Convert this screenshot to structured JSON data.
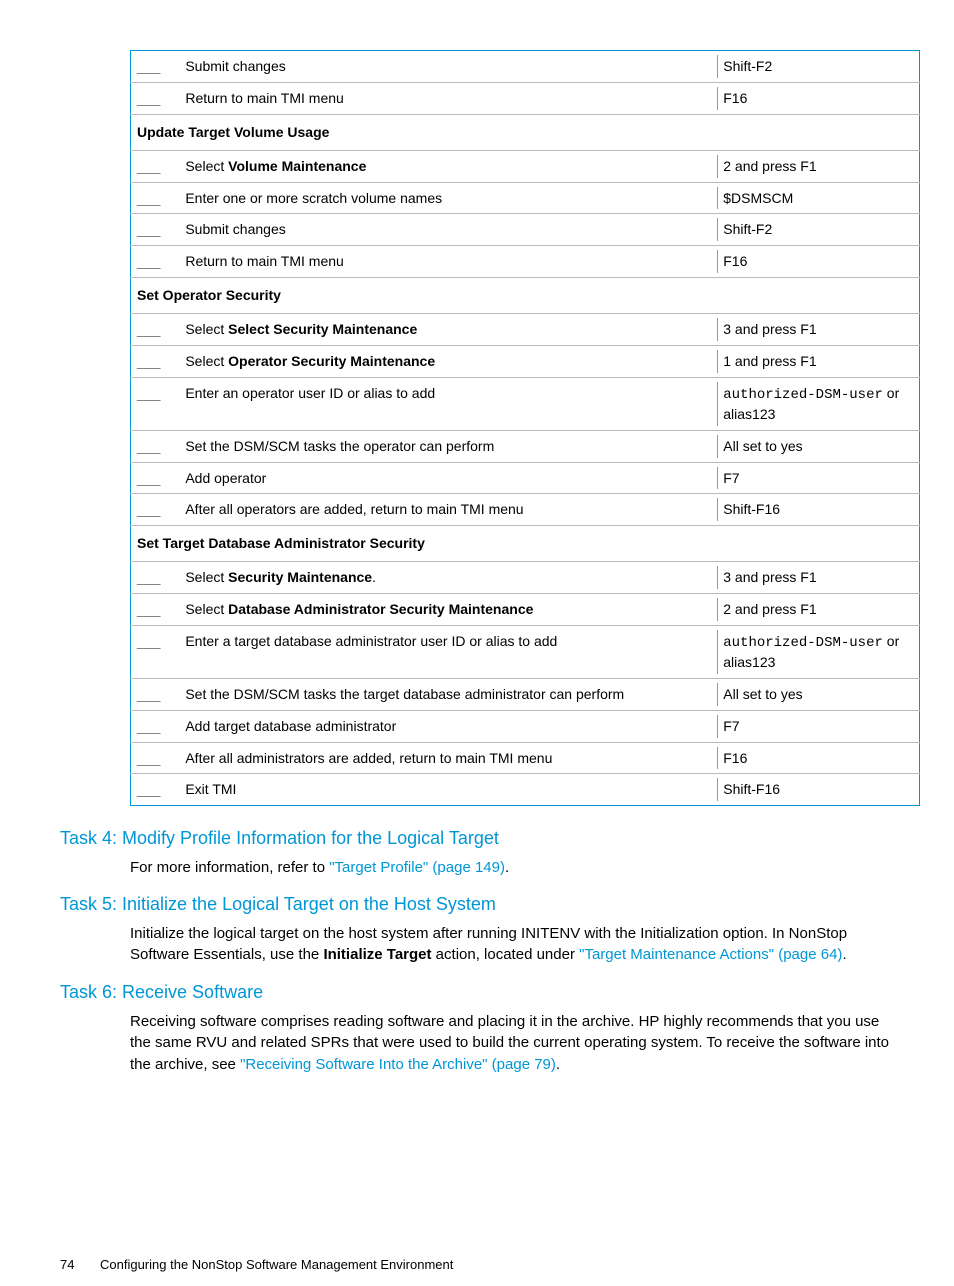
{
  "table": {
    "sections": [
      {
        "header": null,
        "rows": [
          {
            "check": "___",
            "step": "Submit changes",
            "val": "Shift-F2"
          },
          {
            "check": "___",
            "step": "Return to main TMI menu",
            "val": "F16"
          }
        ]
      },
      {
        "header": "Update Target Volume Usage",
        "rows": [
          {
            "check": "___",
            "step_pre": "Select ",
            "step_b": "Volume Maintenance",
            "val": "2 and press F1"
          },
          {
            "check": "___",
            "step": "Enter one or more scratch volume names",
            "val": "$DSMSCM"
          },
          {
            "check": "___",
            "step": "Submit changes",
            "val": "Shift-F2"
          },
          {
            "check": "___",
            "step": "Return to main TMI menu",
            "val": "F16"
          }
        ]
      },
      {
        "header": "Set Operator Security",
        "rows": [
          {
            "check": "___",
            "step_pre": "Select ",
            "step_b": "Select Security Maintenance",
            "val": "3 and press F1"
          },
          {
            "check": "___",
            "step_pre": "Select ",
            "step_b": "Operator Security Maintenance",
            "val": "1 and press F1"
          },
          {
            "check": "___",
            "step": "Enter an operator user ID or alias to add",
            "val_mono": "authorized-DSM-user",
            "val_suffix": " or alias123"
          },
          {
            "check": "___",
            "step": "Set the DSM/SCM tasks the operator can perform",
            "val": "All set to yes"
          },
          {
            "check": "___",
            "step": "Add operator",
            "val": "F7"
          },
          {
            "check": "___",
            "step": "After all operators are added, return to main TMI menu",
            "val": "Shift-F16"
          }
        ]
      },
      {
        "header": "Set Target Database Administrator Security",
        "rows": [
          {
            "check": "___",
            "step_pre": "Select ",
            "step_b": "Security Maintenance",
            "step_post": ".",
            "val": "3 and press F1"
          },
          {
            "check": "___",
            "step_pre": "Select ",
            "step_b": "Database Administrator Security Maintenance",
            "val": "2 and press F1"
          },
          {
            "check": "___",
            "step": "Enter a target database administrator user ID or alias to add",
            "val_mono": "authorized-DSM-user",
            "val_suffix": " or alias123"
          },
          {
            "check": "___",
            "step": "Set the DSM/SCM tasks the target database administrator can perform",
            "val": "All set to yes"
          },
          {
            "check": "___",
            "step": "Add target database administrator",
            "val": "F7"
          },
          {
            "check": "___",
            "step": "After all administrators are added, return to main TMI menu",
            "val": "F16"
          },
          {
            "check": "___",
            "step": "Exit TMI",
            "val": "Shift-F16"
          }
        ]
      }
    ]
  },
  "task4": {
    "title": "Task 4: Modify Profile Information for the Logical Target",
    "body_pre": "For more information, refer to ",
    "body_link": "\"Target Profile\" (page 149)",
    "body_post": "."
  },
  "task5": {
    "title": "Task 5: Initialize the Logical Target on the Host System",
    "body_pre": "Initialize the logical target on the host system after running INITENV with the Initialization option. In NonStop Software Essentials, use the ",
    "body_b": "Initialize Target",
    "body_mid": " action, located under ",
    "body_link": "\"Target Maintenance Actions\" (page 64)",
    "body_post": "."
  },
  "task6": {
    "title": "Task 6: Receive Software",
    "body_pre": "Receiving software comprises reading software and placing it in the archive. HP highly recommends that you use the same RVU and related SPRs that were used to build the current operating system. To receive the software into the archive, see ",
    "body_link": "\"Receiving Software Into the Archive\" (page 79)",
    "body_post": "."
  },
  "footer": {
    "page": "74",
    "title": "Configuring the NonStop Software Management Environment"
  }
}
